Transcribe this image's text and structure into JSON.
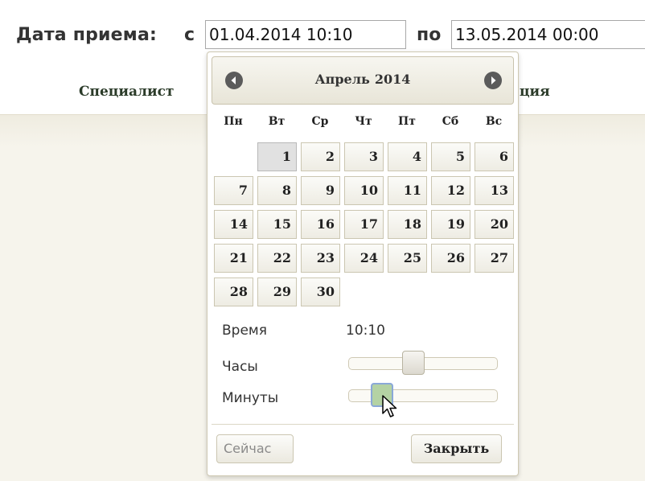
{
  "filter": {
    "label": "Дата приема:",
    "from_label": "с",
    "from_value": "01.04.2014 10:10",
    "to_label": "по",
    "to_value": "13.05.2014 00:00"
  },
  "table": {
    "col_specialist": "Специалист",
    "col_partial": "ция"
  },
  "datepicker": {
    "month": "Апрель",
    "year": "2014",
    "prev_icon": "circle-arrow-left-icon",
    "next_icon": "circle-arrow-right-icon",
    "weekdays": [
      "Пн",
      "Вт",
      "Ср",
      "Чт",
      "Пт",
      "Сб",
      "Вс"
    ],
    "weeks": [
      [
        "",
        "1",
        "2",
        "3",
        "4",
        "5",
        "6"
      ],
      [
        "7",
        "8",
        "9",
        "10",
        "11",
        "12",
        "13"
      ],
      [
        "14",
        "15",
        "16",
        "17",
        "18",
        "19",
        "20"
      ],
      [
        "21",
        "22",
        "23",
        "24",
        "25",
        "26",
        "27"
      ],
      [
        "28",
        "29",
        "30",
        "",
        "",
        "",
        ""
      ]
    ],
    "selected_day": "1",
    "time_label": "Время",
    "time_value": "10:10",
    "hours_label": "Часы",
    "minutes_label": "Минуты",
    "hours_fraction": 0.42,
    "minutes_fraction": 0.17,
    "now_button": "Сейчас",
    "close_button": "Закрыть",
    "accent_color": "#b4d2a4"
  }
}
